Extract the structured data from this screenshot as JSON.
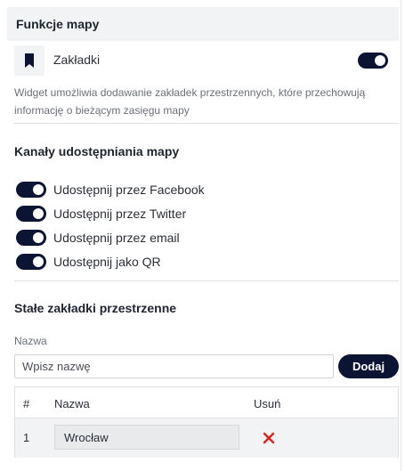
{
  "features": {
    "title": "Funkcje mapy",
    "bookmarks": {
      "label": "Zakładki",
      "enabled": true,
      "icon": "bookmark-icon",
      "description": "Widget umożliwia dodawanie zakładek przestrzennych, które przechowują informację o bieżącym zasięgu mapy"
    }
  },
  "sharing": {
    "title": "Kanały udostępniania mapy",
    "channels": [
      {
        "label": "Udostępnij przez Facebook",
        "enabled": true
      },
      {
        "label": "Udostępnij przez Twitter",
        "enabled": true
      },
      {
        "label": "Udostępnij przez email",
        "enabled": true
      },
      {
        "label": "Udostępnij jako QR",
        "enabled": true
      }
    ]
  },
  "fixed_bookmarks": {
    "title": "Stałe zakładki przestrzenne",
    "name_label": "Nazwa",
    "name_placeholder": "Wpisz nazwę",
    "add_label": "Dodaj",
    "table": {
      "columns": [
        "#",
        "Nazwa",
        "Usuń"
      ],
      "rows": [
        {
          "index": "1",
          "name": "Wrocław"
        }
      ]
    }
  },
  "colors": {
    "accent": "#0b1533",
    "header_bg": "#f2f3f5",
    "delete": "#e0201c"
  }
}
